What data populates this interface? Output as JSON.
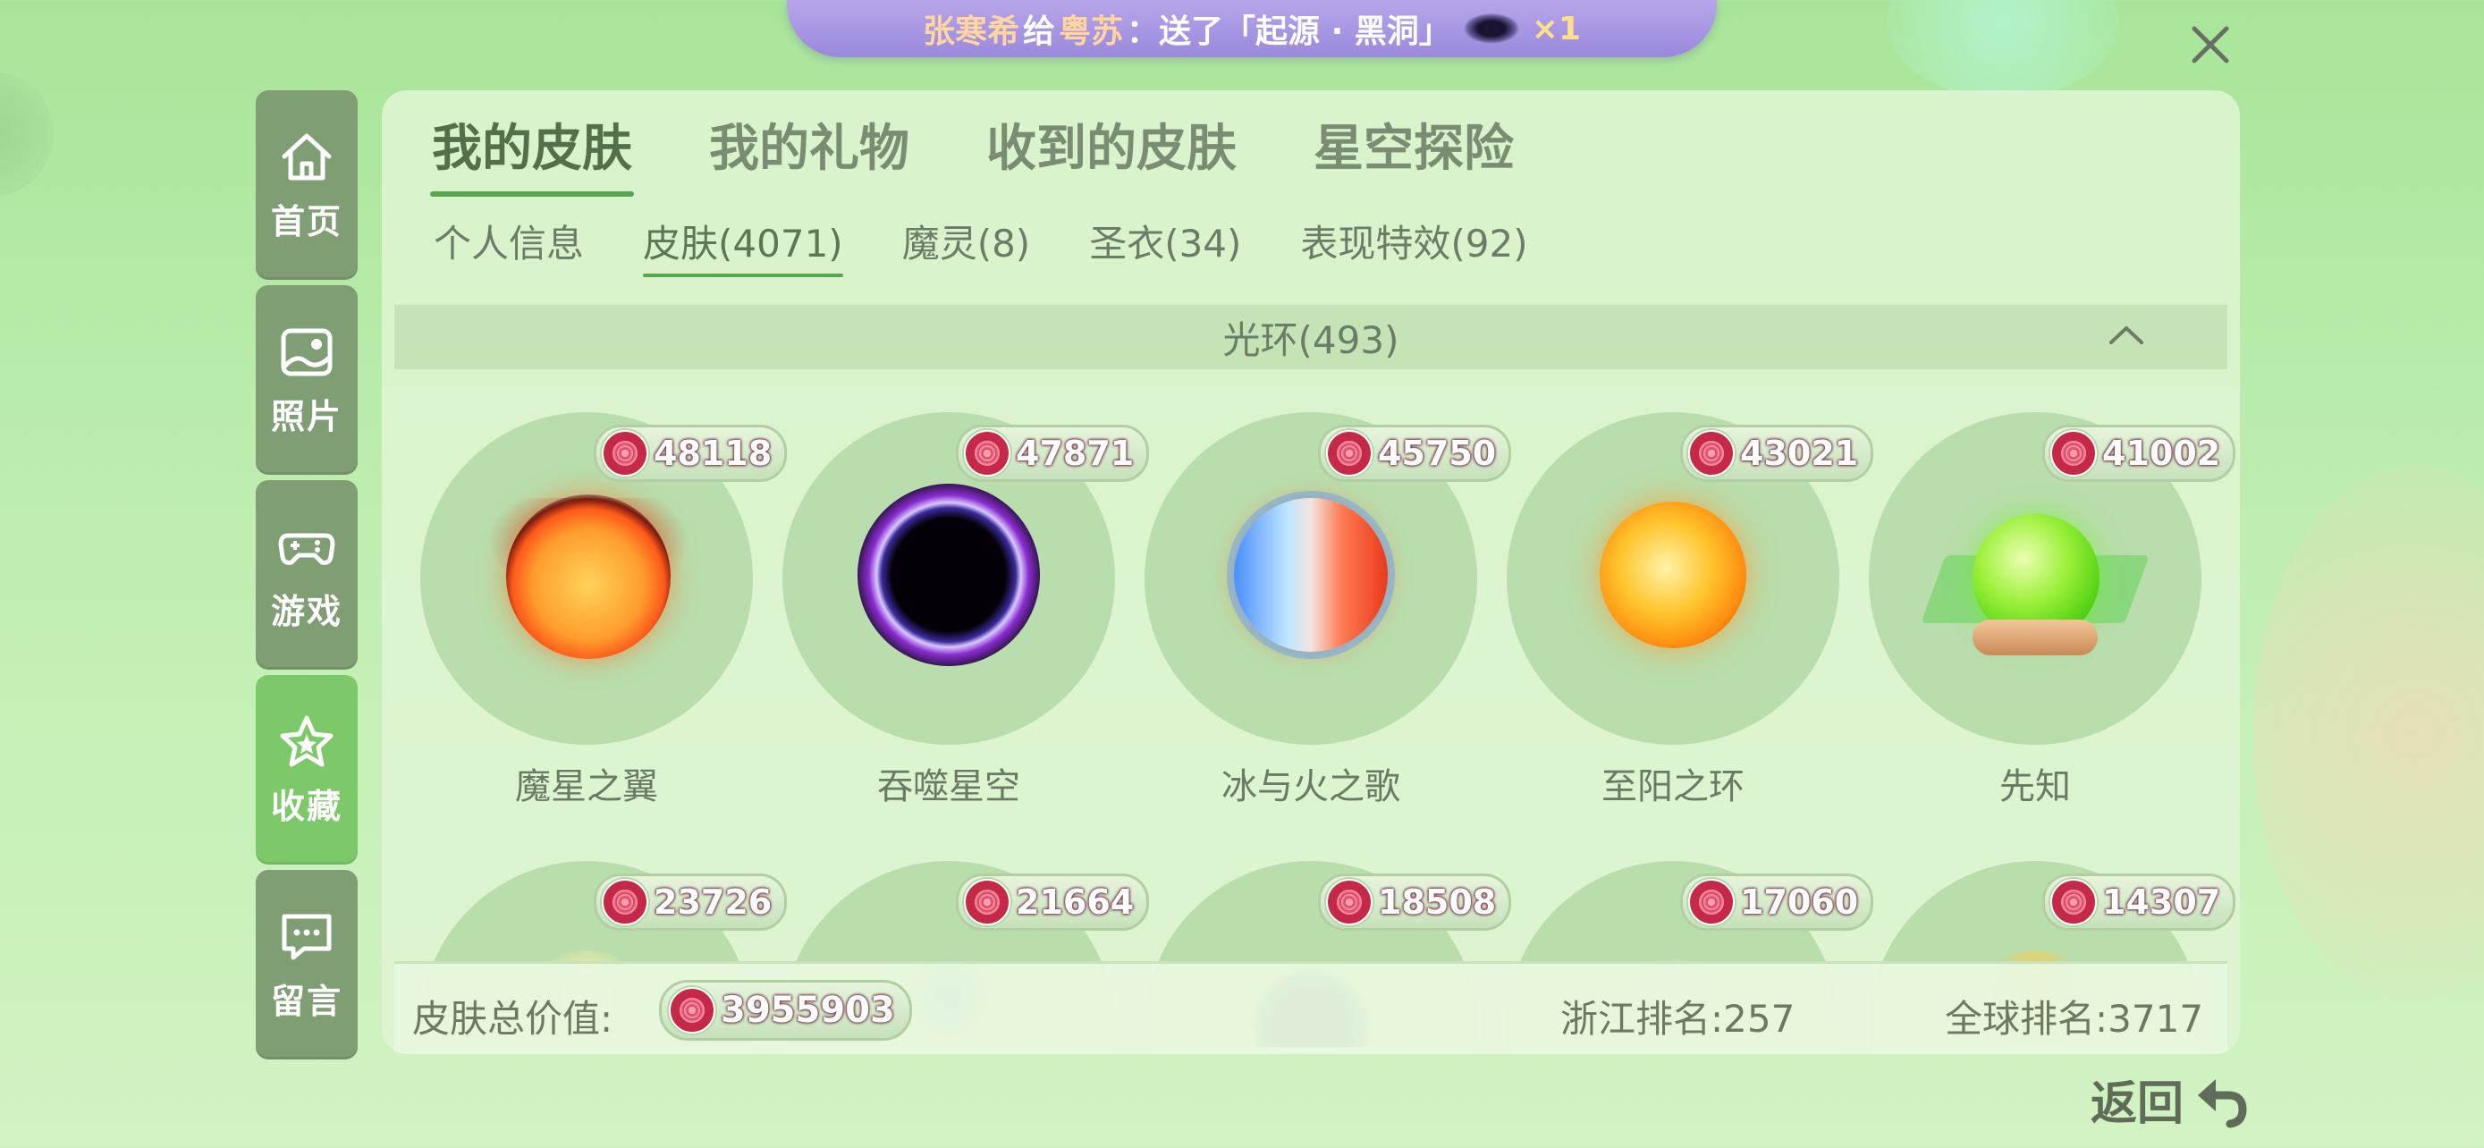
{
  "banner": {
    "sender": "张寒希",
    "gave_word": "给",
    "receiver": "粤苏",
    "action": "：送了「起源 · 黑洞」",
    "count": "×1"
  },
  "sidebar": {
    "items": [
      {
        "label": "首页",
        "icon": "home-icon"
      },
      {
        "label": "照片",
        "icon": "photo-icon"
      },
      {
        "label": "游戏",
        "icon": "gamepad-icon"
      },
      {
        "label": "收藏",
        "icon": "star-icon",
        "active": true
      },
      {
        "label": "留言",
        "icon": "message-icon"
      }
    ]
  },
  "tabs": [
    "我的皮肤",
    "我的礼物",
    "收到的皮肤",
    "星空探险"
  ],
  "subtabs": [
    "个人信息",
    "皮肤(4071)",
    "魔灵(8)",
    "圣衣(34)",
    "表现特效(92)"
  ],
  "section": {
    "title": "光环(493)"
  },
  "items": [
    {
      "name": "魔星之翼",
      "value": "48118"
    },
    {
      "name": "吞噬星空",
      "value": "47871"
    },
    {
      "name": "冰与火之歌",
      "value": "45750"
    },
    {
      "name": "至阳之环",
      "value": "43021"
    },
    {
      "name": "先知",
      "value": "41002"
    },
    {
      "value": "23726"
    },
    {
      "value": "21664"
    },
    {
      "value": "18508"
    },
    {
      "value": "17060"
    },
    {
      "value": "14307"
    }
  ],
  "footer": {
    "total_label": "皮肤总价值:",
    "total_value": "3955903",
    "province_rank": "浙江排名:257",
    "global_rank": "全球排名:3717"
  },
  "back": {
    "label": "返回"
  },
  "colors": {
    "accent_green": "#5aa552",
    "sidebar_active": "#7dc96a",
    "sidebar": "#7f9e74",
    "banner": "#9a89dc"
  }
}
